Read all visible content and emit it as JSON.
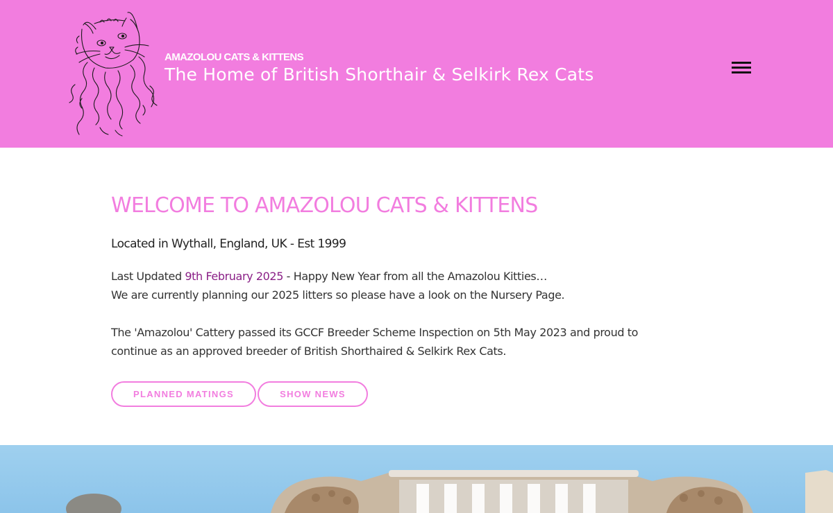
{
  "header": {
    "site_name": "AMAZOLOU CATS & KITTENS",
    "tagline": "The Home of British Shorthair & Selkirk Rex Cats",
    "logo_icon": "cat-line-drawing-icon",
    "menu_icon": "hamburger-menu-icon",
    "background_color": "#f27ddf"
  },
  "main": {
    "heading": "WELCOME TO AMAZOLOU CATS & KITTENS",
    "location": "Located in Wythall, England, UK - Est 1999",
    "update": {
      "prefix": "Last Updated ",
      "date": "9th February 2025",
      "suffix": " - Happy New Year from all the Amazolou Kitties…",
      "line2": "We are currently planning our 2025 litters so please have a look on the Nursery Page."
    },
    "gccf": {
      "line1": "The 'Amazolou' Cattery passed its GCCF Breeder Scheme Inspection on 5th May 2023 and proud to",
      "line2": "continue as an approved breeder of British Shorthaired & Selkirk Rex Cats."
    },
    "buttons": {
      "planned_matings": "PLANNED MATINGS",
      "show_news": "SHOW NEWS"
    }
  },
  "colors": {
    "accent": "#f27ddf",
    "link": "#8a1f86",
    "text": "#333333"
  }
}
